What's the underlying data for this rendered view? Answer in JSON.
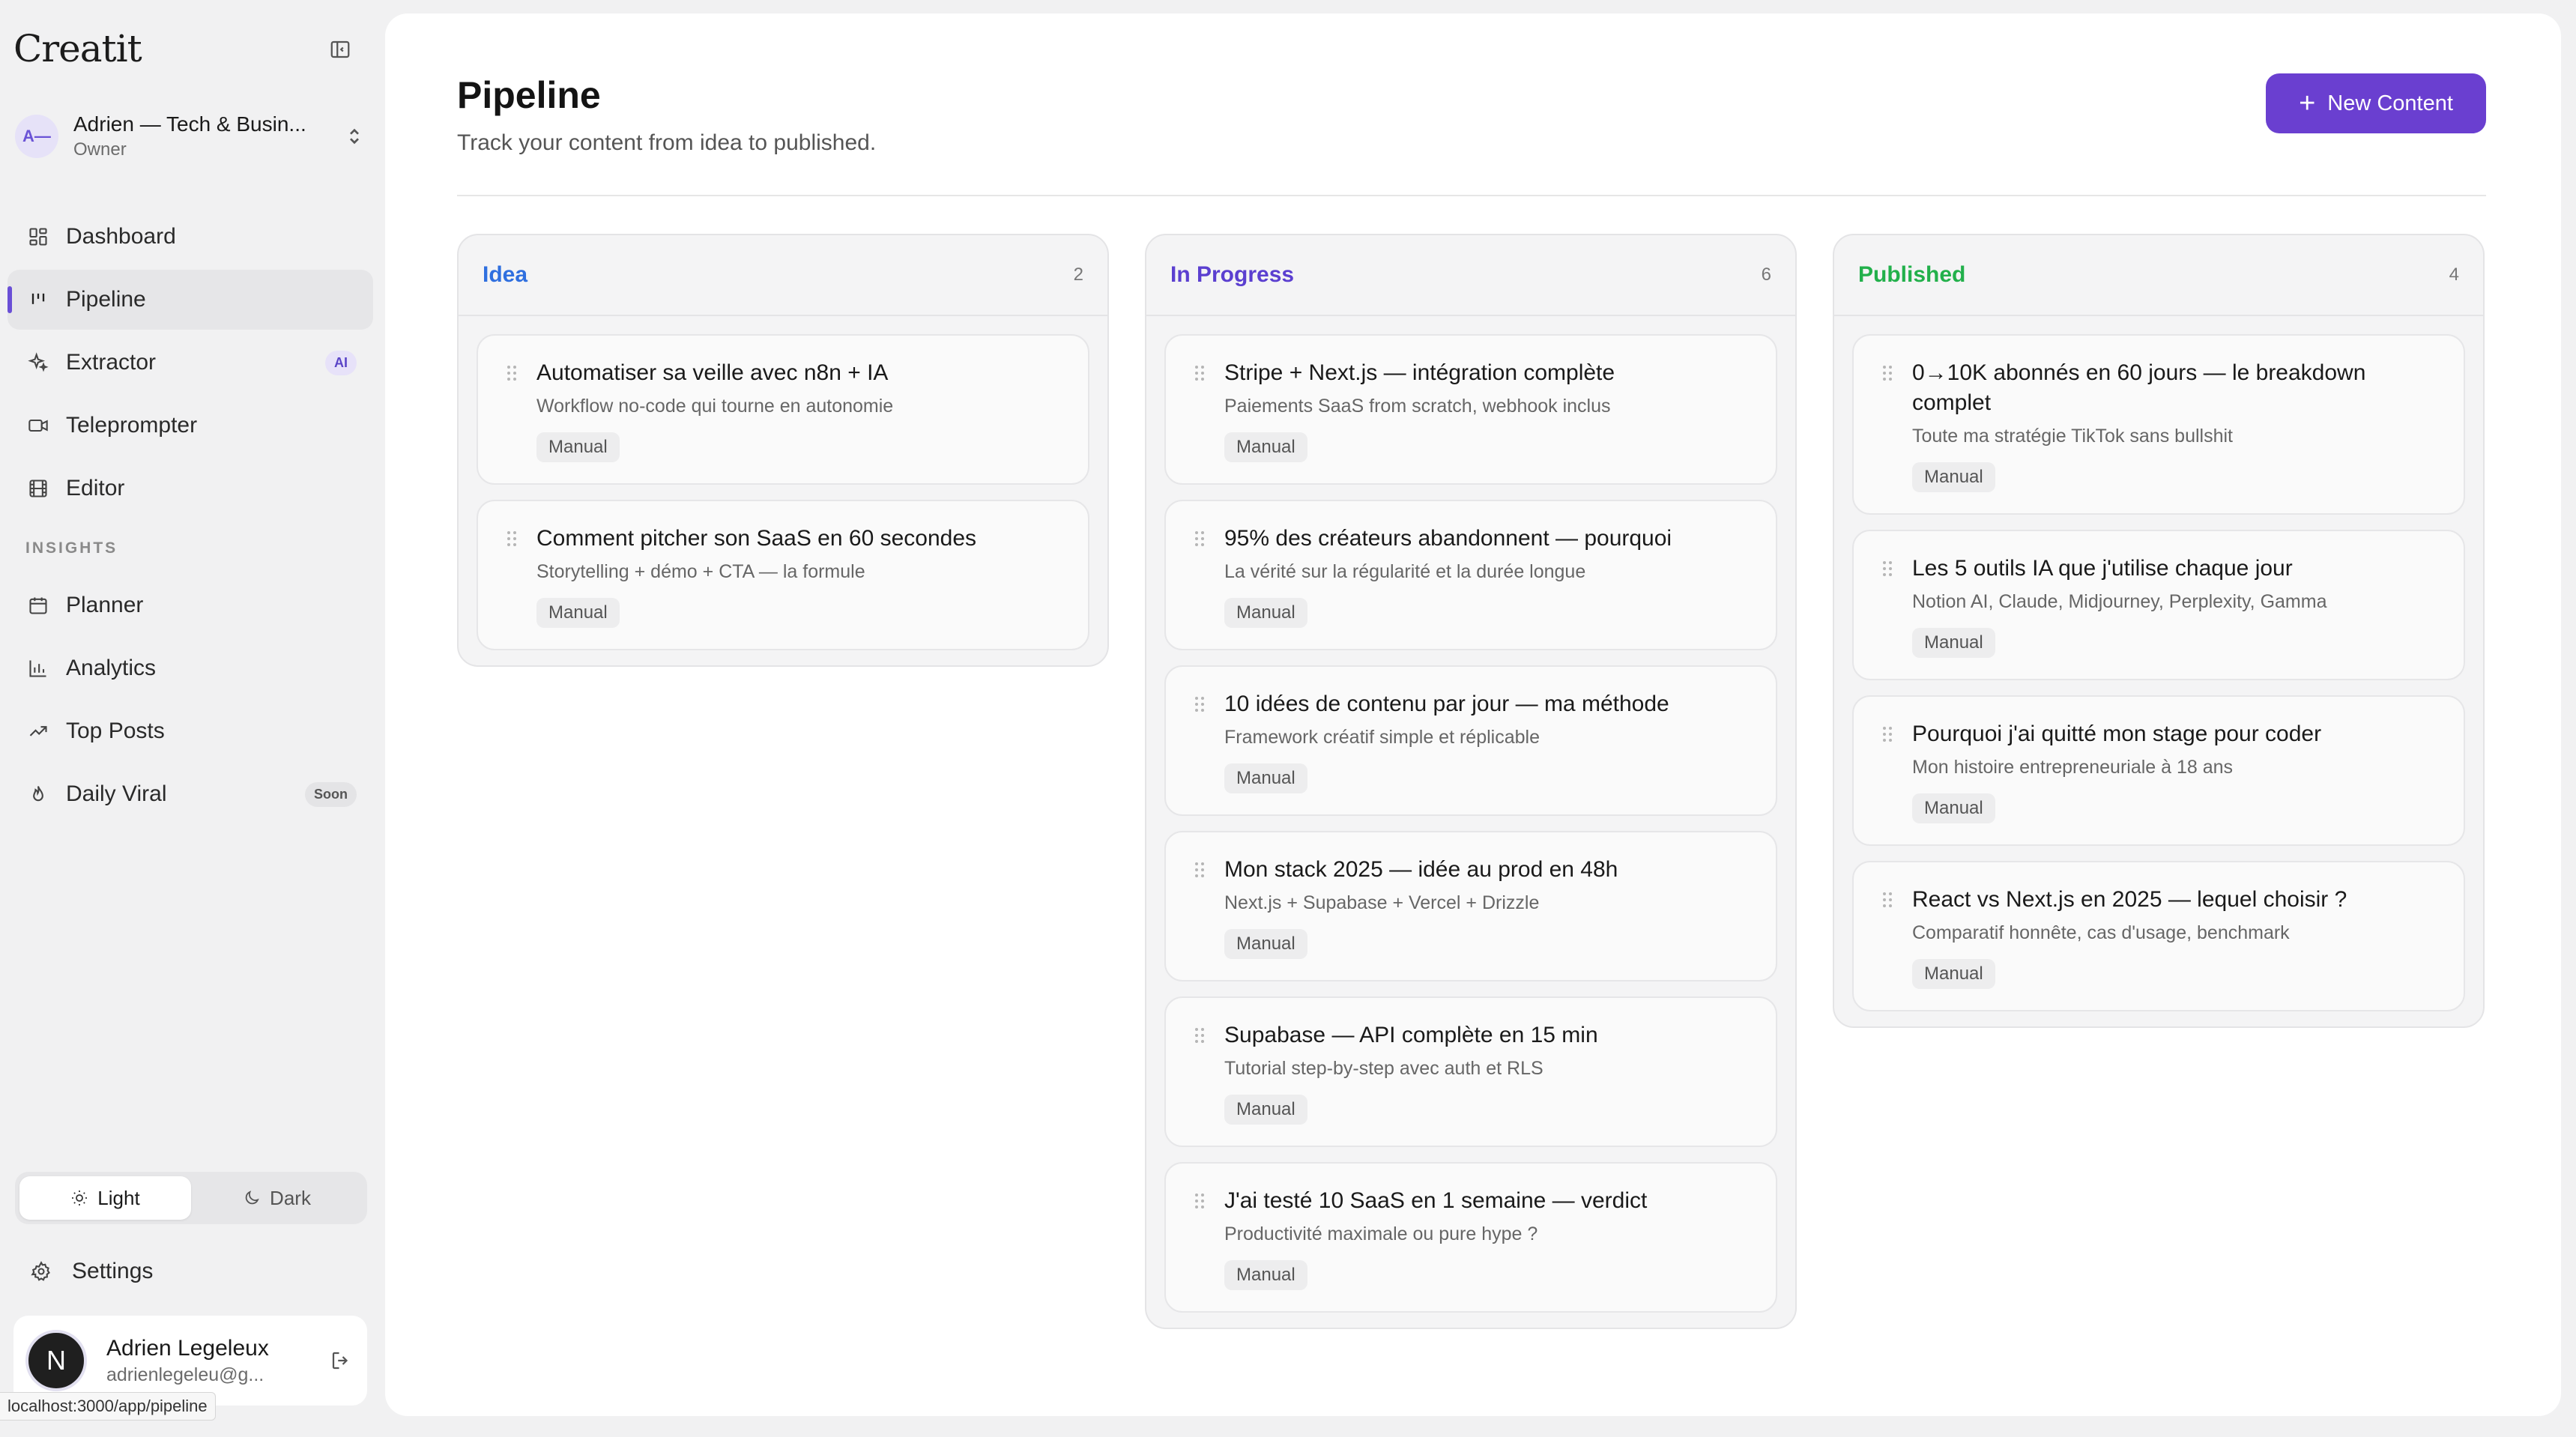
{
  "app": {
    "logo": "Creatit"
  },
  "workspace": {
    "initials": "A—",
    "name": "Adrien — Tech & Busin...",
    "role": "Owner"
  },
  "nav": {
    "items": [
      {
        "label": "Dashboard"
      },
      {
        "label": "Pipeline"
      },
      {
        "label": "Extractor",
        "badge": "AI"
      },
      {
        "label": "Teleprompter"
      },
      {
        "label": "Editor"
      }
    ],
    "section": "INSIGHTS",
    "insights": [
      {
        "label": "Planner"
      },
      {
        "label": "Analytics"
      },
      {
        "label": "Top Posts"
      },
      {
        "label": "Daily Viral",
        "badge": "Soon"
      }
    ]
  },
  "theme": {
    "light": "Light",
    "dark": "Dark",
    "selected": "Light"
  },
  "settings": {
    "label": "Settings"
  },
  "user": {
    "initial": "N",
    "name": "Adrien Legeleux",
    "email": "adrienlegeleu@g..."
  },
  "status_url": "localhost:3000/app/pipeline",
  "page": {
    "title": "Pipeline",
    "subtitle": "Track your content from idea to published.",
    "new_button": "New Content"
  },
  "colors": {
    "accent": "#6a3fd0",
    "idea": "#2f6fdf",
    "in_progress": "#5b3fd0",
    "published": "#22b04b"
  },
  "columns": [
    {
      "title": "Idea",
      "count": "2",
      "cards": [
        {
          "title": "Automatiser sa veille avec n8n + IA",
          "desc": "Workflow no-code qui tourne en autonomie",
          "tag": "Manual"
        },
        {
          "title": "Comment pitcher son SaaS en 60 secondes",
          "desc": "Storytelling + démo + CTA — la formule",
          "tag": "Manual"
        }
      ]
    },
    {
      "title": "In Progress",
      "count": "6",
      "cards": [
        {
          "title": "Stripe + Next.js — intégration complète",
          "desc": "Paiements SaaS from scratch, webhook inclus",
          "tag": "Manual"
        },
        {
          "title": "95% des créateurs abandonnent — pourquoi",
          "desc": "La vérité sur la régularité et la durée longue",
          "tag": "Manual"
        },
        {
          "title": "10 idées de contenu par jour — ma méthode",
          "desc": "Framework créatif simple et réplicable",
          "tag": "Manual"
        },
        {
          "title": "Mon stack 2025 — idée au prod en 48h",
          "desc": "Next.js + Supabase + Vercel + Drizzle",
          "tag": "Manual"
        },
        {
          "title": "Supabase — API complète en 15 min",
          "desc": "Tutorial step-by-step avec auth et RLS",
          "tag": "Manual"
        },
        {
          "title": "J'ai testé 10 SaaS en 1 semaine — verdict",
          "desc": "Productivité maximale ou pure hype ?",
          "tag": "Manual"
        }
      ]
    },
    {
      "title": "Published",
      "count": "4",
      "cards": [
        {
          "title": "0→10K abonnés en 60 jours — le breakdown complet",
          "desc": "Toute ma stratégie TikTok sans bullshit",
          "tag": "Manual"
        },
        {
          "title": "Les 5 outils IA que j'utilise chaque jour",
          "desc": "Notion AI, Claude, Midjourney, Perplexity, Gamma",
          "tag": "Manual"
        },
        {
          "title": "Pourquoi j'ai quitté mon stage pour coder",
          "desc": "Mon histoire entrepreneuriale à 18 ans",
          "tag": "Manual"
        },
        {
          "title": "React vs Next.js en 2025 — lequel choisir ?",
          "desc": "Comparatif honnête, cas d'usage, benchmark",
          "tag": "Manual"
        }
      ]
    }
  ]
}
